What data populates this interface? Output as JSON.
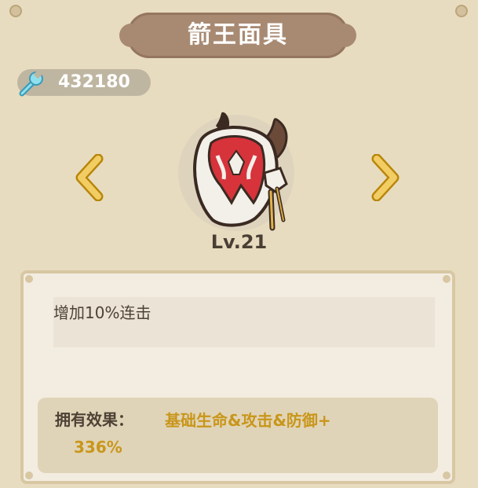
{
  "header": {
    "title": "箭王面具"
  },
  "currency": {
    "icon": "wrench-icon",
    "value": "432180"
  },
  "item": {
    "icon": "demon-mask-icon",
    "level": "Lv.21"
  },
  "nav": {
    "prev_icon": "chevron-left-icon",
    "next_icon": "chevron-right-icon"
  },
  "description": {
    "text": "增加10%连击"
  },
  "effect": {
    "label": "拥有效果：",
    "value_line1": "基础生命&攻击&防御+",
    "value_line2": "336%"
  },
  "colors": {
    "background": "#e8dcc0",
    "title_plate": "#a88a73",
    "arrow_gold": "#e6b84a",
    "effect_gold": "#c9961a",
    "text_dark": "#4d4235"
  }
}
